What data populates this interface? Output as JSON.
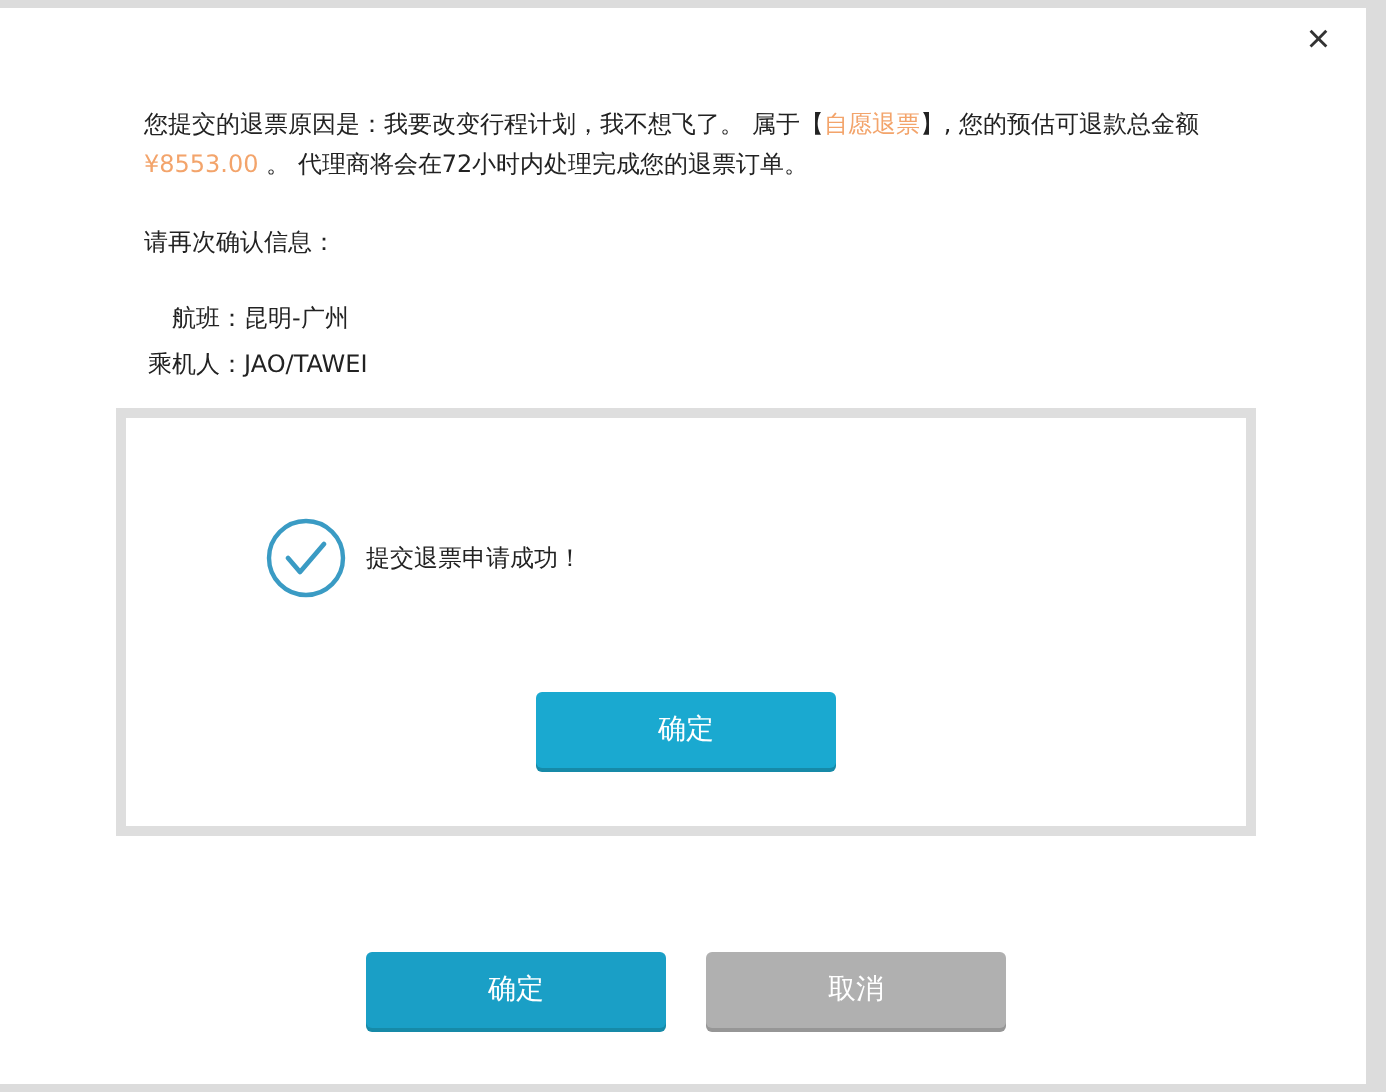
{
  "close_button": "×",
  "message": [
    {
      "text": "您提交的退票原因是：我要改变行程计划，我不想飞了。 属于【",
      "highlight": false
    },
    {
      "text": "自愿退票",
      "highlight": true
    },
    {
      "text": "】, 您的预估可退款总金额 ",
      "highlight": false
    },
    {
      "text": "¥8553.00",
      "highlight": true
    },
    {
      "text": " 。 代理商将会在72小时内处理完成您的退票订单。",
      "highlight": false
    }
  ],
  "confirm_prompt": "请再次确认信息：",
  "details": [
    {
      "label": "航班：",
      "value": "昆明-广州"
    },
    {
      "label": "乘机人：",
      "value": "JAO/TAWEI"
    }
  ],
  "success_box": {
    "message": "提交退票申请成功！",
    "button": "确定"
  },
  "buttons": [
    {
      "label": "确定",
      "kind": "primary"
    },
    {
      "label": "取消",
      "kind": "secondary"
    }
  ]
}
